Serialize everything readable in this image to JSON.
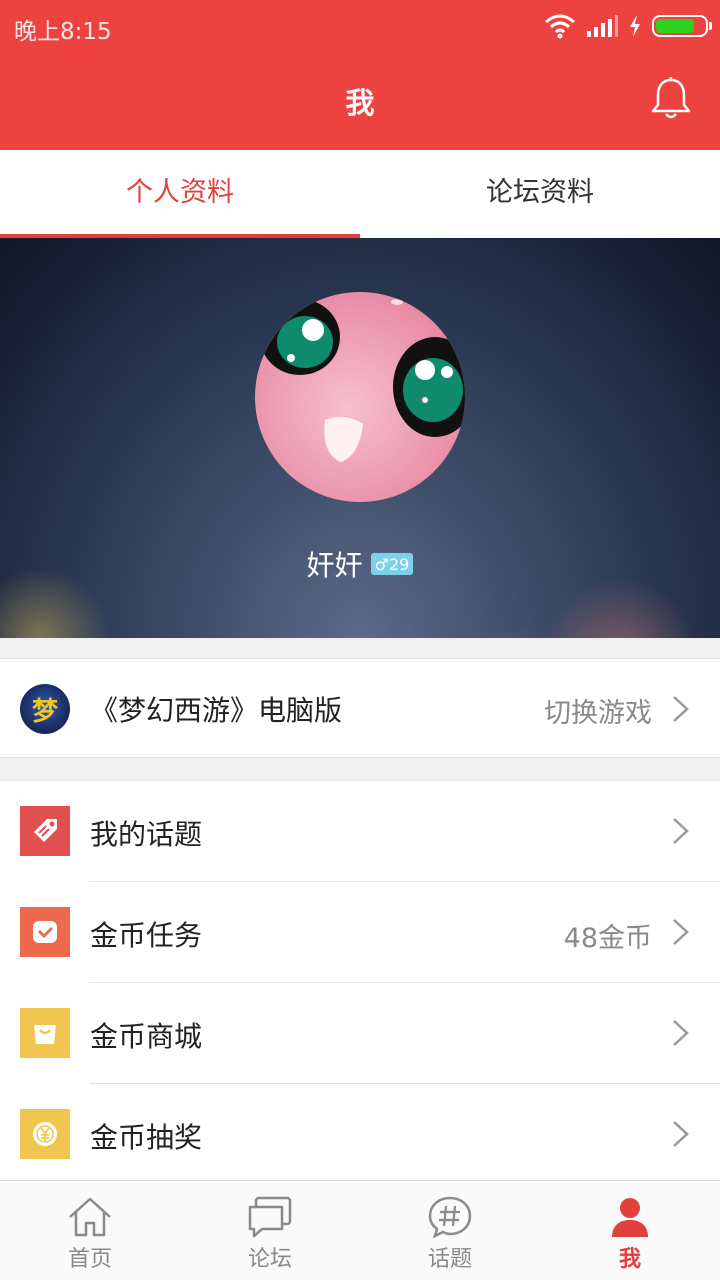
{
  "status_bar": {
    "time": "晚上8:15"
  },
  "header": {
    "title": "我"
  },
  "tabs": [
    {
      "label": "个人资料",
      "active": true
    },
    {
      "label": "论坛资料",
      "active": false
    }
  ],
  "profile": {
    "username": "奸奸",
    "gender_symbol": "♂",
    "level": "29"
  },
  "game": {
    "name": "《梦幻西游》电脑版",
    "logo_text": "梦",
    "action": "切换游戏"
  },
  "menu": [
    {
      "label": "我的话题",
      "value": "",
      "icon": "tag-icon",
      "color": "#e35050"
    },
    {
      "label": "金币任务",
      "value": "48金币",
      "icon": "task-check-icon",
      "color": "#ee6a4f"
    },
    {
      "label": "金币商城",
      "value": "",
      "icon": "shopping-bag-icon",
      "color": "#f0c650"
    },
    {
      "label": "金币抽奖",
      "value": "",
      "icon": "lottery-coin-icon",
      "color": "#f0c650"
    }
  ],
  "bottom_nav": [
    {
      "label": "首页",
      "icon": "home-icon",
      "active": false
    },
    {
      "label": "论坛",
      "icon": "forum-icon",
      "active": false
    },
    {
      "label": "话题",
      "icon": "hashtag-icon",
      "active": false
    },
    {
      "label": "我",
      "icon": "user-icon",
      "active": true
    }
  ],
  "colors": {
    "primary": "#ec4340",
    "accent_text": "#e2403d",
    "battery": "#2dd11e"
  }
}
